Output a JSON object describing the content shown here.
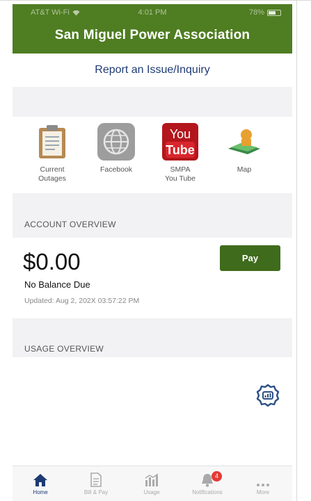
{
  "status_bar": {
    "carrier": "AT&T Wi-Fi",
    "time": "4:01 PM",
    "battery": "78%"
  },
  "header": {
    "title": "San Miguel Power Association"
  },
  "report": {
    "label": "Report an Issue/Inquiry"
  },
  "quick_links": [
    {
      "label": "Current\nOutages",
      "icon": "clipboard-icon"
    },
    {
      "label": "Facebook",
      "icon": "globe-icon"
    },
    {
      "label": "SMPA\nYou Tube",
      "icon": "youtube-icon"
    },
    {
      "label": "Map",
      "icon": "map-icon"
    }
  ],
  "youtube_logo": {
    "top": "You",
    "bottom": "Tube"
  },
  "account": {
    "section_label": "ACCOUNT OVERVIEW",
    "amount": "$0.00",
    "note": "No Balance Due",
    "updated": "Updated: Aug 2, 202X 03:57:22 PM",
    "pay_label": "Pay"
  },
  "usage": {
    "section_label": "USAGE OVERVIEW",
    "settings_icon": "usage-settings-icon"
  },
  "tabs": [
    {
      "label": "Home",
      "icon": "home-icon",
      "active": true
    },
    {
      "label": "Bill & Pay",
      "icon": "bill-icon",
      "active": false
    },
    {
      "label": "Usage",
      "icon": "usage-icon",
      "active": false
    },
    {
      "label": "Notifications",
      "icon": "bell-icon",
      "active": false,
      "badge": "4"
    },
    {
      "label": "More",
      "icon": "more-icon",
      "active": false
    }
  ],
  "colors": {
    "brand_green": "#4f7d22",
    "pay_green": "#3f6b1c",
    "link_blue": "#1f3a73",
    "badge_red": "#e53935"
  }
}
